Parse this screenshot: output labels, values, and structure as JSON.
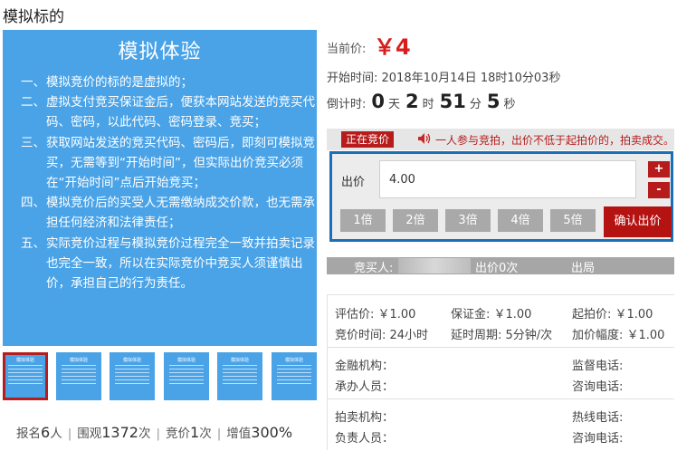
{
  "page": {
    "title": "模拟标的"
  },
  "intro": {
    "title": "模拟体验",
    "items": [
      {
        "num": "一、",
        "text": "模拟竞价的标的是虚拟的；"
      },
      {
        "num": "二、",
        "text": "虚拟支付竞买保证金后，便获本网站发送的竞买代码、密码，以此代码、密码登录、竞买；"
      },
      {
        "num": "三、",
        "text": "获取网站发送的竞买代码、密码后，即刻可模拟竞买，无需等到“开始时间”，但实际出价竞买必须在“开始时间”点后开始竞买；"
      },
      {
        "num": "四、",
        "text": "模拟竞价后的买受人无需缴纳成交价款，也无需承担任何经济和法律责任；"
      },
      {
        "num": "五、",
        "text": "实际竞价过程与模拟竞价过程完全一致并拍卖记录也完全一致，所以在实际竞价中竞买人须谨慎出价，承担自己的行为责任。"
      }
    ]
  },
  "thumbnails": {
    "title": "模拟体验",
    "count": 6,
    "active_index": 0
  },
  "stats": {
    "signup_label": "报名",
    "signup_count": "6",
    "signup_unit": "人",
    "views_label": "围观",
    "views_count": "1372",
    "views_unit": "次",
    "bids_label": "竞价",
    "bids_count": "1",
    "bids_unit": "次",
    "premium_label": "增值",
    "premium_value": "300%"
  },
  "price": {
    "label": "当前价:",
    "value": "￥4"
  },
  "start_time": "开始时间: 2018年10月14日 18时10分03秒",
  "countdown": {
    "label": "倒计时:",
    "days": "0",
    "days_unit": "天",
    "hours": "2",
    "hours_unit": "时",
    "minutes": "51",
    "minutes_unit": "分",
    "seconds": "5",
    "seconds_unit": "秒"
  },
  "bid_status": {
    "badge": "正在竞价",
    "rule": "一人参与竞拍，出价不低于起拍价的，拍卖成交。"
  },
  "bid_form": {
    "label": "出价",
    "value": "4.00",
    "plus": "+",
    "minus": "-",
    "multipliers": [
      "1倍",
      "2倍",
      "3倍",
      "4倍",
      "5倍"
    ],
    "confirm": "确认出价"
  },
  "record": {
    "buyer": "竞买人:",
    "bid": "出价0次",
    "outcome": "出局"
  },
  "details": {
    "appraisal": "评估价: ￥1.00",
    "deposit": "保证金: ￥1.00",
    "start_price": "起拍价: ￥1.00",
    "bid_duration": "竞价时间: 24小时",
    "delay": "延时周期: 5分钟/次",
    "increment": "加价幅度: ￥1.00"
  },
  "contacts": {
    "finance_org": "金融机构：",
    "supervise_phone": "监督电话:",
    "handler": "承办人员：",
    "consult_phone": "咨询电话:",
    "auction_org": "拍卖机构：",
    "hotline": "热线电话:",
    "manager": "负责人员：",
    "consult_phone2": "咨询电话:"
  },
  "colors": {
    "panel_blue": "#4aa3e7",
    "accent_red": "#b71c1c",
    "price_red": "#d71e1e",
    "box_border": "#1b6fb8"
  }
}
